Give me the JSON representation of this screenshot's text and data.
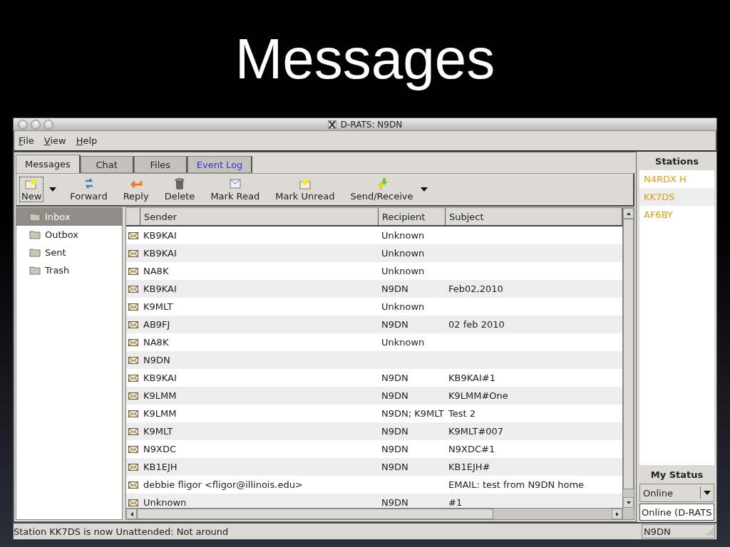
{
  "slide_title": "Messages",
  "window": {
    "title": "D-RATS: N9DN"
  },
  "menu": [
    {
      "label": "File"
    },
    {
      "label": "View"
    },
    {
      "label": "Help"
    }
  ],
  "tabs": [
    {
      "label": "Messages",
      "selected": true,
      "attention": false
    },
    {
      "label": "Chat",
      "selected": false,
      "attention": false
    },
    {
      "label": "Files",
      "selected": false,
      "attention": false
    },
    {
      "label": "Event Log",
      "selected": false,
      "attention": true
    }
  ],
  "toolbar": [
    {
      "label": "New",
      "dropdown": true,
      "focused": true
    },
    {
      "label": "Forward",
      "dropdown": false,
      "focused": false
    },
    {
      "label": "Reply",
      "dropdown": false,
      "focused": false
    },
    {
      "label": "Delete",
      "dropdown": false,
      "focused": false
    },
    {
      "label": "Mark Read",
      "dropdown": false,
      "focused": false
    },
    {
      "label": "Mark Unread",
      "dropdown": false,
      "focused": false
    },
    {
      "label": "Send/Receive",
      "dropdown": true,
      "focused": false
    }
  ],
  "folders": [
    {
      "label": "Inbox",
      "selected": true
    },
    {
      "label": "Outbox",
      "selected": false
    },
    {
      "label": "Sent",
      "selected": false
    },
    {
      "label": "Trash",
      "selected": false
    }
  ],
  "table": {
    "columns": [
      "Sender",
      "Recipient",
      "Subject"
    ],
    "rows": [
      {
        "sender": "KB9KAI",
        "recipient": "Unknown"
      },
      {
        "sender": "KB9KAI",
        "recipient": "Unknown"
      },
      {
        "sender": "NA8K",
        "recipient": "Unknown"
      },
      {
        "sender": "KB9KAI",
        "recipient": "N9DN",
        "subject": "Feb02,2010"
      },
      {
        "sender": "K9MLT",
        "recipient": "Unknown"
      },
      {
        "sender": "AB9FJ",
        "recipient": "N9DN",
        "subject": "02 feb 2010"
      },
      {
        "sender": "NA8K",
        "recipient": "Unknown"
      },
      {
        "sender": "N9DN"
      },
      {
        "sender": "KB9KAI",
        "recipient": "N9DN",
        "subject": "KB9KAI#1"
      },
      {
        "sender": "K9LMM",
        "recipient": "N9DN",
        "subject": "K9LMM#One"
      },
      {
        "sender": "K9LMM",
        "recipient": "N9DN; K9MLT",
        "subject": "Test 2"
      },
      {
        "sender": "K9MLT",
        "recipient": "N9DN",
        "subject": "K9MLT#007"
      },
      {
        "sender": "N9XDC",
        "recipient": "N9DN",
        "subject": "N9XDC#1"
      },
      {
        "sender": "KB1EJH",
        "recipient": "N9DN",
        "subject": "KB1EJH#"
      },
      {
        "sender": "debbie fligor <fligor@illinois.edu>",
        "subject": "EMAIL: test from N9DN home"
      },
      {
        "sender": "Unknown",
        "recipient": "N9DN",
        "subject": "#1"
      }
    ]
  },
  "stations": {
    "title": "Stations",
    "items": [
      {
        "label": "N4RDX H",
        "color": "#d4a017"
      },
      {
        "label": "KK7DS",
        "color": "#d4a017"
      },
      {
        "label": "AF6BY",
        "color": "#d4a017"
      }
    ]
  },
  "my_status": {
    "title": "My Status",
    "value": "Online",
    "message": "Online (D-RATS"
  },
  "status_bar": {
    "text": "Station KK7DS is now Unattended: Not around",
    "callsign": "N9DN"
  }
}
